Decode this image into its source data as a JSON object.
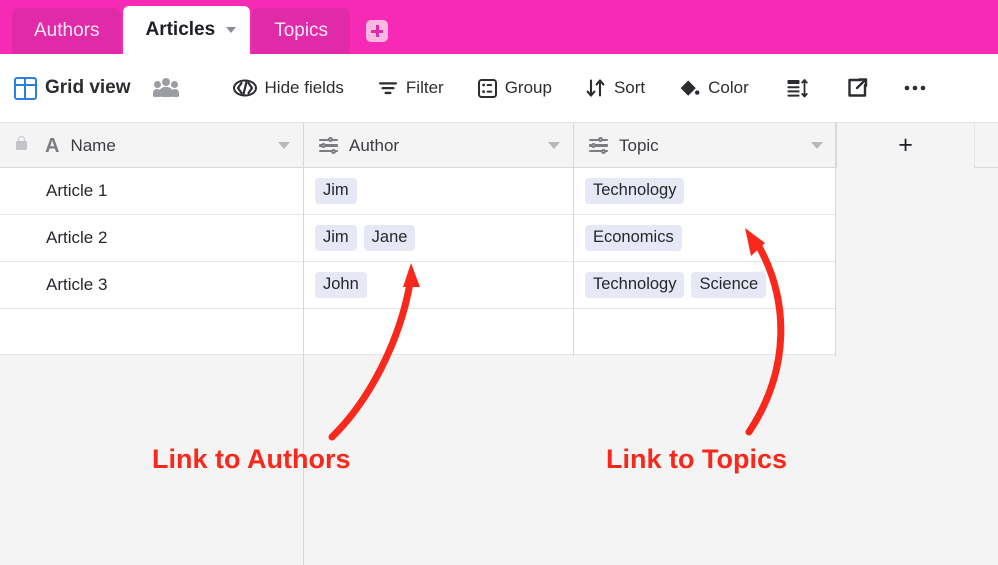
{
  "tabbar": {
    "tabs": [
      {
        "label": "Authors",
        "active": false
      },
      {
        "label": "Articles",
        "active": true
      },
      {
        "label": "Topics",
        "active": false
      }
    ],
    "add_tab_label": "+",
    "bar_color": "#f72ab5",
    "tab_color": "#e02aa8"
  },
  "toolbar": {
    "view_name": "Grid view",
    "collaborators_icon": "people-icon",
    "items": [
      {
        "label": "Hide fields",
        "icon": "hide-fields-icon"
      },
      {
        "label": "Filter",
        "icon": "filter-icon"
      },
      {
        "label": "Group",
        "icon": "group-icon"
      },
      {
        "label": "Sort",
        "icon": "sort-icon"
      },
      {
        "label": "Color",
        "icon": "paint-bucket-icon"
      }
    ],
    "row_height_icon": "row-height-icon",
    "share_icon": "share-external-icon",
    "more_icon": "ellipsis-icon"
  },
  "grid": {
    "columns": [
      {
        "name": "Name",
        "icon": "text-field-icon",
        "locked": true
      },
      {
        "name": "Author",
        "icon": "linked-record-icon",
        "locked": false
      },
      {
        "name": "Topic",
        "icon": "linked-record-icon",
        "locked": false
      }
    ],
    "add_field_label": "+",
    "rows": [
      {
        "name": "Article 1",
        "authors": [
          "Jim"
        ],
        "topics": [
          "Technology"
        ]
      },
      {
        "name": "Article 2",
        "authors": [
          "Jim",
          "Jane"
        ],
        "topics": [
          "Economics"
        ]
      },
      {
        "name": "Article 3",
        "authors": [
          "John"
        ],
        "topics": [
          "Technology",
          "Science"
        ]
      },
      {
        "name": "",
        "authors": [],
        "topics": []
      }
    ],
    "chip_bg": "#e6e9f5"
  },
  "annotations": {
    "color": "#f8291c",
    "left_label": "Link to Authors",
    "right_label": "Link to Topics"
  }
}
